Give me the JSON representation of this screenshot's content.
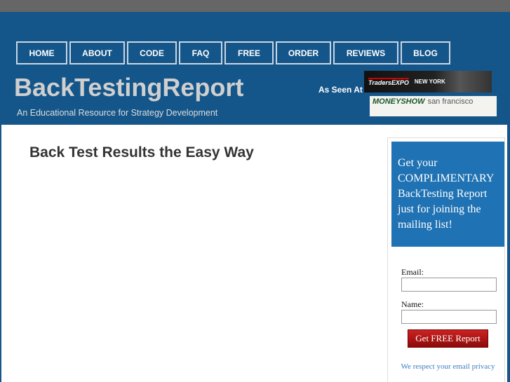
{
  "nav": [
    "HOME",
    "ABOUT",
    "CODE",
    "FAQ",
    "FREE",
    "ORDER",
    "REVIEWS",
    "BLOG"
  ],
  "header": {
    "title": "BackTestingReport",
    "tagline": "An Educational Resource for Strategy Development",
    "as_seen_at": "As Seen At"
  },
  "ads": [
    {
      "brand": "TradersEXPO",
      "city": "NEW YORK"
    },
    {
      "brand": "MONEYSHOW",
      "city": "san francisco"
    }
  ],
  "main": {
    "heading": "Back Test Results the Easy Way"
  },
  "signup": {
    "promo": "Get your COMPLIMENTARY BackTesting Report just for joining the mailing list!",
    "email_label": "Email:",
    "name_label": "Name:",
    "email_value": "",
    "name_value": "",
    "button": "Get FREE Report",
    "privacy": "We respect your email privacy"
  },
  "colors": {
    "header_bg": "#15568a",
    "promo_bg": "#1f72b3",
    "button": "#a51414"
  }
}
